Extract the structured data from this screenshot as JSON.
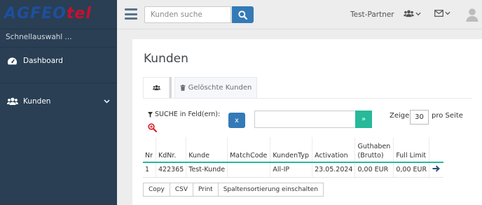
{
  "brand": {
    "logo_part1": "AGFEO",
    "logo_part2": "tel"
  },
  "sidebar": {
    "quick_select": "Schnellauswahl ...",
    "items": [
      {
        "label": "Dashboard",
        "icon": "dashboard-icon"
      },
      {
        "label": "Kunden",
        "icon": "users-icon"
      }
    ]
  },
  "topbar": {
    "search_placeholder": "Kunden suche",
    "partner_name": "Test-Partner"
  },
  "page": {
    "title": "Kunden"
  },
  "tabs": {
    "deleted_label": "Gelöschte Kunden"
  },
  "filter": {
    "search_label": "SUCHE in Feld(ern):",
    "clear_label": "x",
    "go_label": "»",
    "show_label": "Zeige:",
    "show_value": "30",
    "per_page_label": "pro Seite"
  },
  "table": {
    "headers": [
      "Nr",
      "KdNr.",
      "Kunde",
      "MatchCode",
      "KundenTyp",
      "Activation",
      "Guthaben (Brutto)",
      "Full Limit",
      ""
    ],
    "rows": [
      [
        "1",
        "422365",
        "Test-Kunde",
        "",
        "All-IP",
        "23.05.2024",
        "0,00 EUR",
        "0,00 EUR",
        ""
      ]
    ]
  },
  "export_buttons": [
    "Copy",
    "CSV",
    "Print",
    "Spaltensortierung einschalten"
  ],
  "colors": {
    "sidebar": "#2a3f54",
    "primary": "#337ab7",
    "success": "#26b99a"
  }
}
